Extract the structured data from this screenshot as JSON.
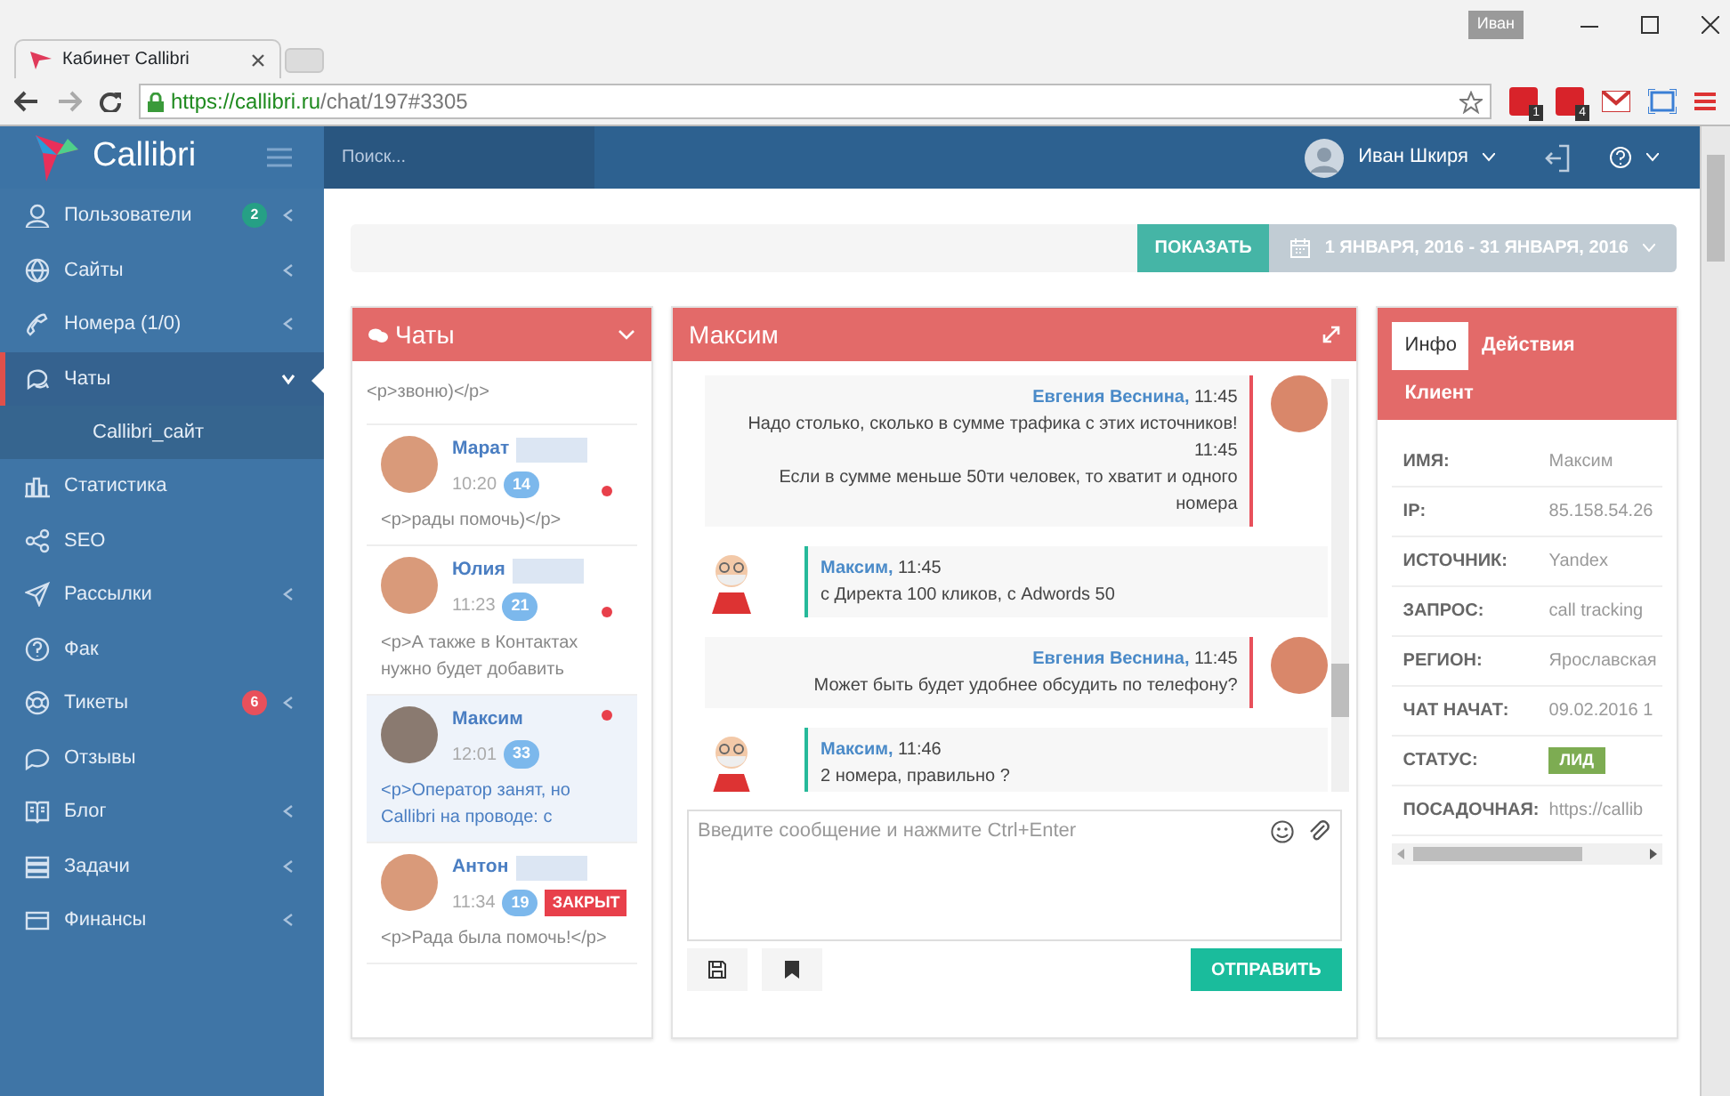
{
  "browser": {
    "tab_title": "Кабинет Callibri",
    "profile": "Иван",
    "url": {
      "scheme": "https://",
      "host": "callibri.ru",
      "path": "/chat/197#3305"
    },
    "extension_badges": [
      "1",
      "4"
    ]
  },
  "header": {
    "logo": "Callibri",
    "search": {
      "placeholder": "Поиск..."
    },
    "user": "Иван Шкиря"
  },
  "sidebar": {
    "items": [
      {
        "label": "Пользователи",
        "badge": "2",
        "color": "#26a085",
        "arrow": true,
        "selected": false,
        "expanded": false
      },
      {
        "label": "Сайты",
        "arrow": true,
        "selected": false,
        "expanded": false
      },
      {
        "label": "Номера (1/0)",
        "arrow": true,
        "selected": false,
        "expanded": false
      },
      {
        "label": "Чаты",
        "arrow": true,
        "selected": true,
        "expanded": true,
        "children": [
          {
            "label": "Callibri_сайт"
          }
        ]
      },
      {
        "label": "Статистика",
        "arrow": false,
        "selected": false
      },
      {
        "label": "SEO",
        "arrow": false,
        "selected": false
      },
      {
        "label": "Рассылки",
        "arrow": true,
        "selected": false,
        "expanded": false
      },
      {
        "label": "Фак",
        "arrow": false,
        "selected": false
      },
      {
        "label": "Тикеты",
        "badge": "6",
        "color": "#e8505b",
        "arrow": true,
        "selected": false,
        "expanded": false
      },
      {
        "label": "Отзывы",
        "arrow": false,
        "selected": false
      },
      {
        "label": "Блог",
        "arrow": true,
        "selected": false,
        "expanded": false
      },
      {
        "label": "Задачи",
        "arrow": true,
        "selected": false,
        "expanded": false
      },
      {
        "label": "Финансы",
        "arrow": true,
        "selected": false,
        "expanded": false
      }
    ]
  },
  "date_filter": {
    "button": "ПОКАЗАТЬ",
    "range": "1 ЯНВАРЯ, 2016 - 31 ЯНВАРЯ, 2016"
  },
  "chats": {
    "title": "Чаты",
    "top_snippet": "<p>звоню)</p>",
    "items": [
      {
        "name": "Марат",
        "redacted": true,
        "time": "10:20",
        "count": "14",
        "unread": true,
        "snippet": "<p>рады помочь)</p>",
        "selected": false
      },
      {
        "name": "Юлия",
        "redacted": true,
        "time": "11:23",
        "count": "21",
        "unread": true,
        "snippet": "<p>А также в Контактах нужно будет добавить",
        "selected": false
      },
      {
        "name": "Максим",
        "redacted": false,
        "time": "12:01",
        "count": "33",
        "unread": true,
        "snippet": "<p>Оператор занят, но Callibri на проводе: с",
        "selected": true
      },
      {
        "name": "Антон",
        "redacted": true,
        "time": "11:34",
        "count": "19",
        "tag": "ЗАКРЫТ",
        "unread": false,
        "snippet": "<p>Рада была помочь!</p>",
        "selected": false
      }
    ]
  },
  "conversation": {
    "title": "Максим",
    "messages": [
      {
        "kind": "operator",
        "author": "Евгения Веснина,",
        "time": "11:45",
        "lines": [
          "Надо столько, сколько в сумме трафика с этих источников!",
          "11:45",
          "Если в сумме меньше 50ти человек, то хватит и одного номера"
        ]
      },
      {
        "kind": "client",
        "author": "Максим,",
        "time": "11:45",
        "lines": [
          "с Директа 100 кликов, с Adwords 50"
        ]
      },
      {
        "kind": "operator",
        "author": "Евгения Веснина,",
        "time": "11:45",
        "lines": [
          "Может быть будет удобнее обсудить по телефону?"
        ]
      },
      {
        "kind": "client",
        "author": "Максим,",
        "time": "11:46",
        "lines": [
          "2 номера, правильно ?"
        ]
      }
    ],
    "composer": {
      "placeholder": "Введите сообщение и нажмите Ctrl+Enter"
    },
    "send": "ОТПРАВИТЬ"
  },
  "info": {
    "tabs": [
      {
        "label": "Инфо",
        "selected": true
      },
      {
        "label": "Действия",
        "selected": false
      },
      {
        "label": "Клиент",
        "selected": false
      }
    ],
    "rows": [
      {
        "label": "ИМЯ:",
        "value": "Максим"
      },
      {
        "label": "IP:",
        "value": "85.158.54.26"
      },
      {
        "label": "ИСТОЧНИК:",
        "value": "Yandex"
      },
      {
        "label": "ЗАПРОС:",
        "value": "call tracking"
      },
      {
        "label": "РЕГИОН:",
        "value": "Ярославская"
      },
      {
        "label": "ЧАТ НАЧАТ:",
        "value": "09.02.2016 1"
      },
      {
        "label": "СТАТУС:",
        "value": "ЛИД",
        "kind": "tag"
      },
      {
        "label": "ПОСАДОЧНАЯ:",
        "value": "https://callib"
      }
    ]
  }
}
